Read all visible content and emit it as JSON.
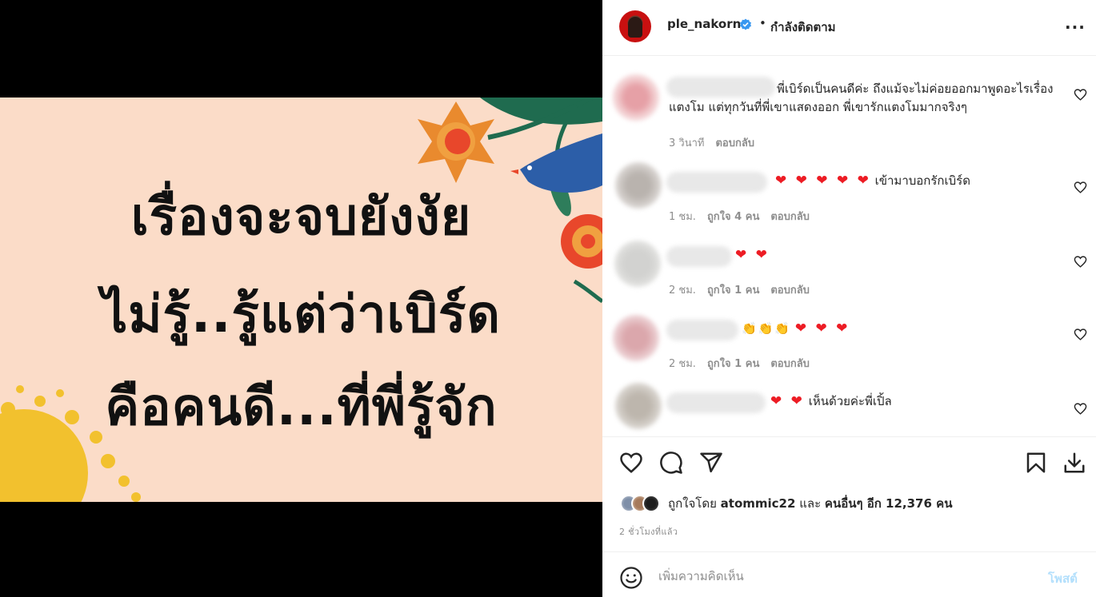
{
  "post_image": {
    "lines": [
      "เรื่องจะจบยังงัย",
      "ไม่รู้..รู้แต่ว่าเบิร์ด",
      "คือคนดี...ที่พี่รู้จัก"
    ]
  },
  "header": {
    "username": "ple_nakorn",
    "separator": "•",
    "follow_status": "กำลังติดตาม",
    "more": "···"
  },
  "comments": [
    {
      "text": "พี่เบิร์ดเป็นคนดีค่ะ ถึงแม้จะไม่ค่อยออกมาพูดอะไรเรื่องแตงโม แต่ทุกวันที่พี่เขาแสดงออก พี่เขารักแตงโมมากจริงๆ",
      "time": "3 วินาที",
      "reply": "ตอบกลับ"
    },
    {
      "emoji": "❤ ❤ ❤ ❤ ❤",
      "text": "เข้ามาบอกรักเบิร์ด",
      "time": "1 ชม.",
      "likes": "ถูกใจ 4 คน",
      "reply": "ตอบกลับ"
    },
    {
      "emoji": "❤ ❤",
      "time": "2 ชม.",
      "likes": "ถูกใจ 1 คน",
      "reply": "ตอบกลับ"
    },
    {
      "emoji_claps": "👏👏👏",
      "emoji": "❤ ❤ ❤",
      "time": "2 ชม.",
      "likes": "ถูกใจ 1 คน",
      "reply": "ตอบกลับ"
    },
    {
      "emoji": "❤ ❤",
      "text": "เห็นด้วยค่ะพี่เปิ้ล"
    }
  ],
  "likes": {
    "prefix": "ถูกใจโดย",
    "user": "atommic22",
    "conj": "และ",
    "others": "คนอื่นๆ อีก 12,376 คน"
  },
  "time_ago": "2 ชั่วโมงที่แล้ว",
  "add_comment": {
    "placeholder": "เพิ่มความคิดเห็น",
    "post_label": "โพสต์"
  },
  "colors": {
    "heart": "#ed1c24",
    "verified": "#3897f0",
    "post_button_disabled": "#b2dffc",
    "image_background": "#fbdcc8"
  },
  "icons": [
    "heart-icon",
    "comment-icon",
    "share-icon",
    "bookmark-icon",
    "download-icon",
    "smile-icon",
    "verified-icon",
    "more-icon"
  ]
}
